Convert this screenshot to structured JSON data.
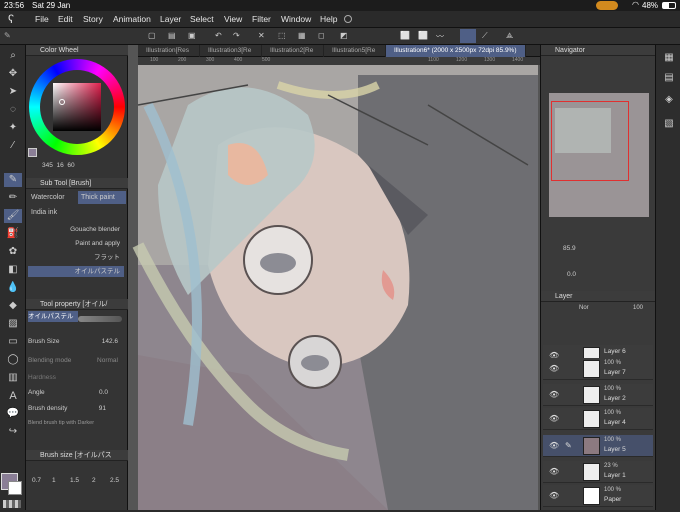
{
  "status": {
    "time": "23:56",
    "date": "Sat 29 Jan",
    "battery": "48%"
  },
  "menu": [
    "File",
    "Edit",
    "Story",
    "Animation",
    "Layer",
    "Select",
    "View",
    "Filter",
    "Window",
    "Help"
  ],
  "doc_tabs": [
    "Illustration[Res",
    "Illustration3[Re",
    "Illustration2[Re",
    "Illustration5[Re",
    "Illustration6* (2000 x 2500px 72dpi 85.9%)"
  ],
  "color_wheel": {
    "title": "Color Wheel",
    "readout": [
      "345",
      "16",
      "60"
    ]
  },
  "subtool": {
    "title": "Sub Tool [Brush]",
    "tabs": [
      "Watercolor",
      "Thick paint",
      "India ink"
    ],
    "brushes": [
      "Gouache blender",
      "Paint and apply",
      "フラット",
      "オイルパステル"
    ]
  },
  "tool_property": {
    "title": "Tool property [オイル/",
    "brush_name": "オイルパステル",
    "rows": [
      {
        "label": "Brush Size",
        "value": "142.6"
      },
      {
        "label": "Blending mode",
        "value": "Normal"
      },
      {
        "label": "Hardness",
        "value": ""
      },
      {
        "label": "Angle",
        "value": "0.0"
      },
      {
        "label": "Brush density",
        "value": "91"
      },
      {
        "label": "Blend brush tip with Darker",
        "value": ""
      }
    ]
  },
  "brush_size": {
    "title": "Brush size [オイルパス",
    "values": [
      "0.7",
      "1",
      "1.5",
      "2",
      "2.5"
    ]
  },
  "navigator": {
    "title": "Navigator",
    "zoom": "85.9",
    "angle": "0.0"
  },
  "layer_panel": {
    "title": "Layer",
    "blend": "Nor",
    "opacity": "100",
    "layers": [
      {
        "pct": "",
        "name": "Layer 6"
      },
      {
        "pct": "100 %",
        "name": "Layer 7"
      },
      {
        "pct": "100 %",
        "name": "Layer 2"
      },
      {
        "pct": "100 %",
        "name": "Layer 4"
      },
      {
        "pct": "100 %",
        "name": "Layer 5"
      },
      {
        "pct": "23 %",
        "name": "Layer 1"
      },
      {
        "pct": "100 %",
        "name": "Paper"
      }
    ]
  },
  "ruler": [
    "100",
    "200",
    "300",
    "400",
    "500",
    "1100",
    "1200",
    "1300",
    "1400"
  ]
}
